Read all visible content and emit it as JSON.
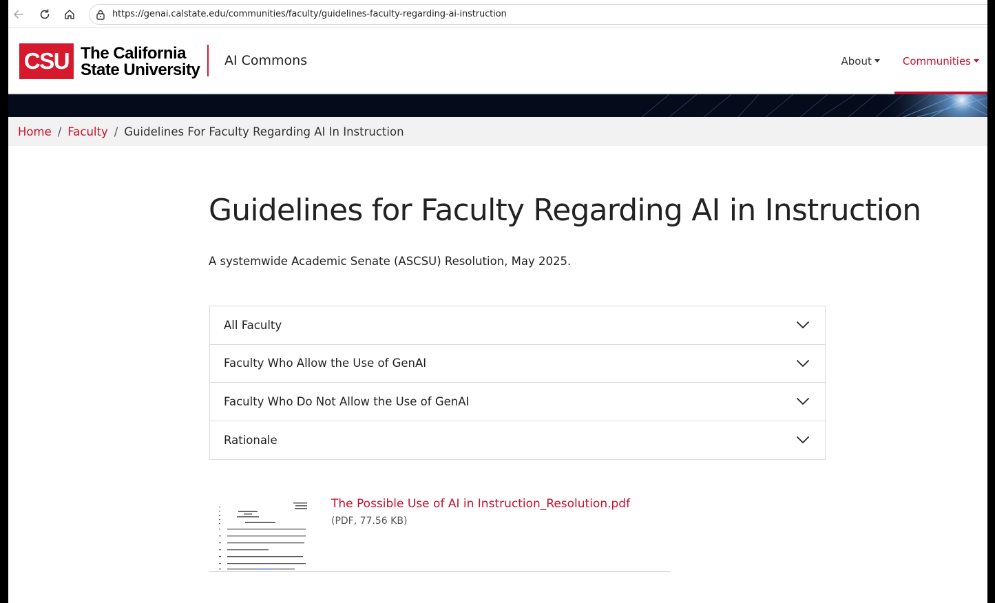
{
  "browser": {
    "url": "https://genai.calstate.edu/communities/faculty/guidelines-faculty-regarding-ai-instruction"
  },
  "header": {
    "logo_abbr": "CSU",
    "logo_line1": "The California",
    "logo_line2": "State University",
    "site_name": "AI Commons",
    "nav": [
      {
        "label": "About",
        "active": false
      },
      {
        "label": "Communities",
        "active": true
      }
    ]
  },
  "breadcrumb": {
    "home": "Home",
    "faculty": "Faculty",
    "current": "Guidelines For Faculty Regarding AI In Instruction"
  },
  "main": {
    "title": "Guidelines for Faculty Regarding AI in Instruction",
    "subtitle": "A systemwide Academic Senate (ASCSU) Resolution, May 2025.",
    "accordion": [
      "All Faculty",
      "Faculty Who Allow the Use of GenAI",
      "Faculty Who Do Not Allow the Use of GenAI",
      "Rationale"
    ],
    "file": {
      "name": "The Possible Use of AI in Instruction_Resolution.pdf",
      "meta": "(PDF, 77.56 KB)"
    }
  },
  "colors": {
    "brand_red": "#c8102e",
    "logo_red": "#d7192d",
    "banner_dark": "#050b1a"
  }
}
